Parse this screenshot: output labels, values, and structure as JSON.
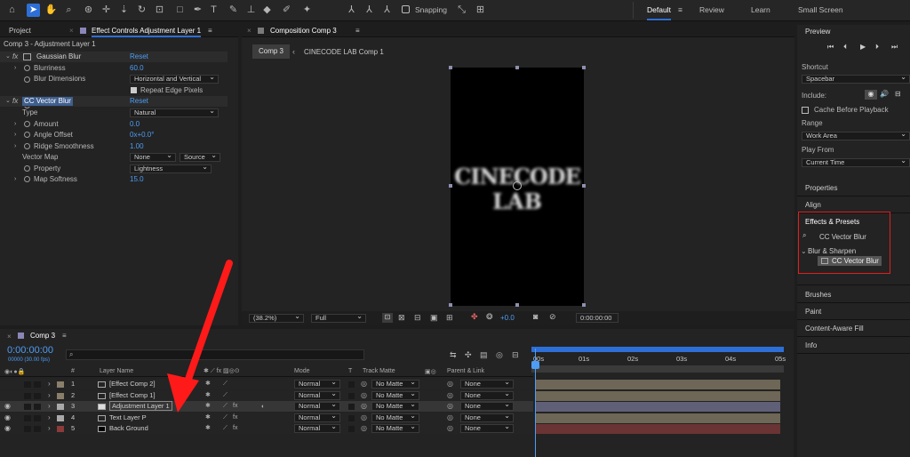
{
  "workspace": {
    "items": [
      "Default",
      "Review",
      "Learn",
      "Small Screen"
    ],
    "snapping": "Snapping"
  },
  "tabs": {
    "project": "Project",
    "effect_controls": "Effect Controls Adjustment Layer 1",
    "composition": "Composition Comp 3",
    "preview": "Preview"
  },
  "effect_controls": {
    "path": "Comp 3 - Adjustment Layer 1",
    "gaussian": {
      "name": "Gaussian Blur",
      "reset": "Reset",
      "blurriness_label": "Blurriness",
      "blurriness": "60.0",
      "dimensions_label": "Blur Dimensions",
      "dimensions": "Horizontal and Vertical",
      "repeat_label": "Repeat Edge Pixels"
    },
    "vector": {
      "name": "CC Vector Blur",
      "reset": "Reset",
      "type_label": "Type",
      "type": "Natural",
      "amount_label": "Amount",
      "amount": "0.0",
      "angle_label": "Angle Offset",
      "angle": "0x+0.0°",
      "ridge_label": "Ridge Smoothness",
      "ridge": "1.00",
      "map_label": "Vector Map",
      "map": "None",
      "map_src": "Source",
      "property_label": "Property",
      "property": "Lightness",
      "softness_label": "Map Softness",
      "softness": "15.0"
    }
  },
  "composition": {
    "crumb_active": "Comp 3",
    "crumb_next": "CINECODE LAB Comp 1",
    "canvas_text_1": "CINECODE",
    "canvas_text_2": "LAB",
    "zoom": "(38.2%)",
    "resolution": "Full",
    "exposure": "+0.0",
    "timecode": "0:00:00:00"
  },
  "preview_panel": {
    "shortcut_label": "Shortcut",
    "shortcut": "Spacebar",
    "include_label": "Include:",
    "cache_label": "Cache Before Playback",
    "range_label": "Range",
    "range": "Work Area",
    "playfrom_label": "Play From",
    "playfrom": "Current Time"
  },
  "right_panels": {
    "properties": "Properties",
    "align": "Align",
    "effects_presets": "Effects & Presets",
    "search": "CC Vector Blur",
    "category": "Blur & Sharpen",
    "result": "CC Vector Blur",
    "brushes": "Brushes",
    "paint": "Paint",
    "content_aware": "Content-Aware Fill",
    "info": "Info"
  },
  "timeline": {
    "comp_tab": "Comp 3",
    "timecode": "0:00:00:00",
    "fps": "00000 (30.00 fps)",
    "headers": {
      "num": "#",
      "layer": "Layer Name",
      "mode": "Mode",
      "t": "T",
      "track": "Track Matte",
      "parent": "Parent & Link"
    },
    "ruler": [
      "00s",
      "01s",
      "02s",
      "03s",
      "04s",
      "05s"
    ],
    "layers": [
      {
        "num": "1",
        "name": "[Effect Comp 2]",
        "mode": "Normal",
        "matte": "No Matte",
        "parent": "None"
      },
      {
        "num": "2",
        "name": "[Effect Comp 1]",
        "mode": "Normal",
        "matte": "No Matte",
        "parent": "None"
      },
      {
        "num": "3",
        "name": "Adjustment Layer 1",
        "mode": "Normal",
        "matte": "No Matte",
        "parent": "None"
      },
      {
        "num": "4",
        "name": "Text Layer P",
        "mode": "Normal",
        "matte": "No Matte",
        "parent": "None"
      },
      {
        "num": "5",
        "name": "Back Ground",
        "mode": "Normal",
        "matte": "No Matte",
        "parent": "None"
      }
    ]
  },
  "colors": {
    "accent": "#2d6fd6",
    "highlight": "#e02020",
    "timecode": "#4d9df5"
  }
}
